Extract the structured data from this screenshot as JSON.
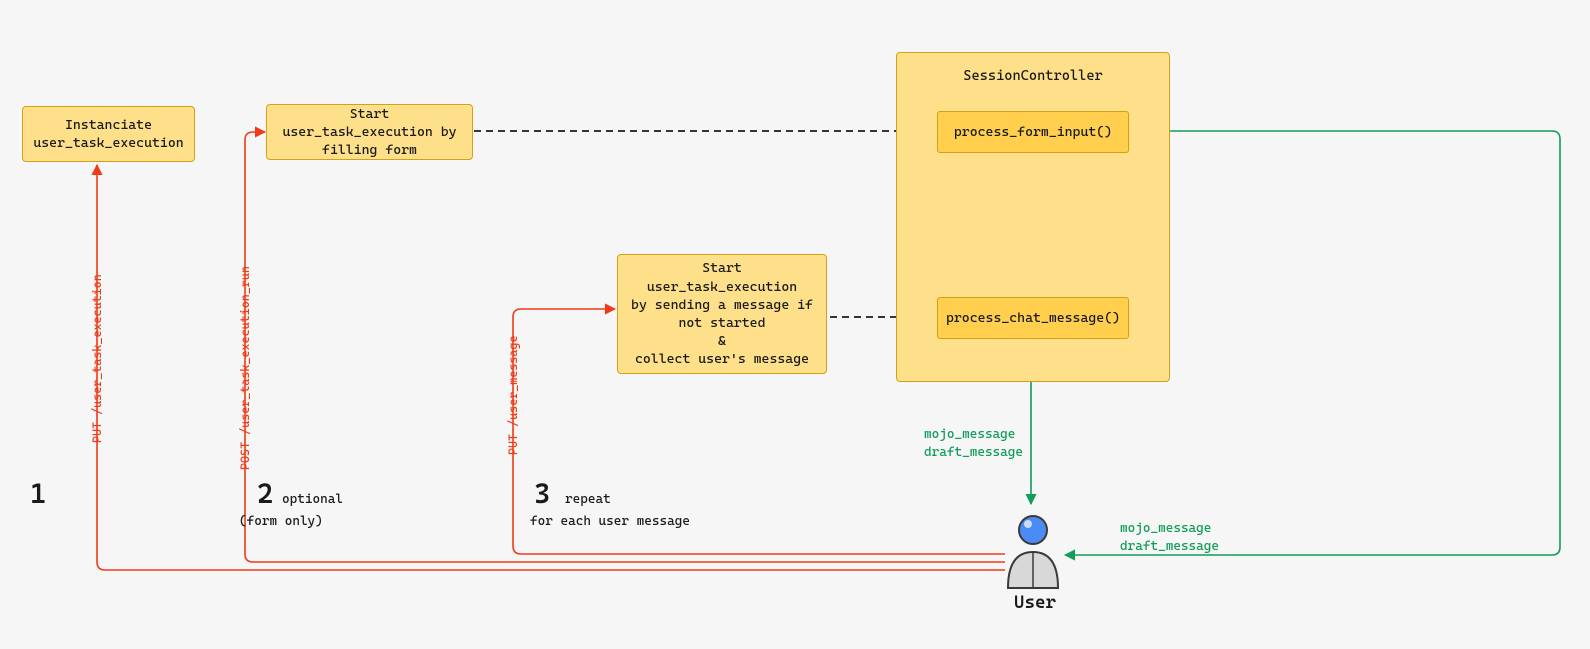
{
  "nodes": {
    "instantiate": "Instanciate\nuser_task_execution",
    "start_form": "Start user_task_execution by\nfilling form",
    "start_msg": "Start user_task_execution\nby sending a message if\nnot started\n&\ncollect user's message",
    "controller_title": "SessionController",
    "process_form": "process_form_input()",
    "process_chat": "process_chat_message()"
  },
  "edges": {
    "put_ute": "PUT /user_task_execution",
    "post_ute_run": "POST /user_task_execution_run",
    "put_msg": "PUT /user_message",
    "mojo": "mojo_message",
    "draft": "draft_message"
  },
  "steps": {
    "s1": {
      "num": "1"
    },
    "s2": {
      "num": "2",
      "sub1": "optional",
      "sub2": "(form only)"
    },
    "s3": {
      "num": "3",
      "sub1": "repeat",
      "sub2": "for each user message"
    }
  },
  "user": "User"
}
